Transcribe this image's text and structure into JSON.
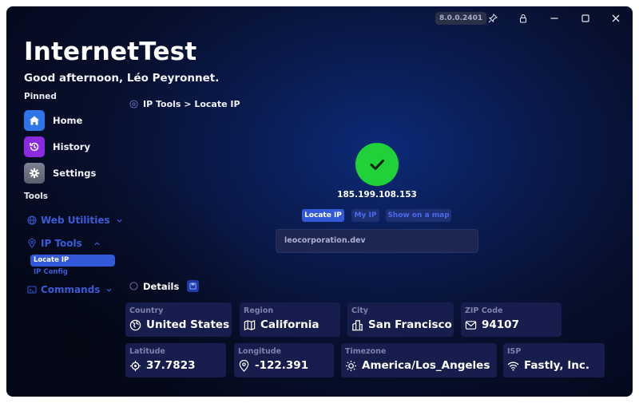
{
  "window": {
    "version": "8.0.0.2401",
    "title": "InternetTest",
    "greeting": "Good afternoon, Léo Peyronnet."
  },
  "sidebar": {
    "pinned_label": "Pinned",
    "pinned": [
      {
        "label": "Home",
        "icon": "home-icon",
        "color": "#2f74e8"
      },
      {
        "label": "History",
        "icon": "history-icon",
        "color": "#8a2be2"
      },
      {
        "label": "Settings",
        "icon": "gear-icon",
        "color": "#6d7280"
      }
    ],
    "tools_label": "Tools",
    "tools": [
      {
        "label": "Web Utilities",
        "icon": "globe-icon"
      },
      {
        "label": "IP Tools",
        "icon": "location-pin-icon",
        "sub": [
          "Locate IP",
          "IP Config"
        ]
      },
      {
        "label": "Commands",
        "icon": "terminal-icon"
      }
    ]
  },
  "main": {
    "breadcrumb": "IP Tools > Locate IP",
    "ip_address": "185.199.108.153",
    "actions": [
      "Locate IP",
      "My IP",
      "Show on a map"
    ],
    "input_value": "leocorporation.dev",
    "details_label": "Details",
    "details": [
      {
        "label": "Country",
        "value": "United States",
        "icon": "globe-icon"
      },
      {
        "label": "Region",
        "value": "California",
        "icon": "map-icon"
      },
      {
        "label": "City",
        "value": "San Francisco",
        "icon": "city-icon"
      },
      {
        "label": "ZIP Code",
        "value": "94107",
        "icon": "mail-icon"
      },
      {
        "label": "Latitude",
        "value": "37.7823",
        "icon": "crosshair-icon"
      },
      {
        "label": "Longitude",
        "value": "-122.391",
        "icon": "location-pin-icon"
      },
      {
        "label": "Timezone",
        "value": "America/Los_Angeles",
        "icon": "sun-icon"
      },
      {
        "label": "ISP",
        "value": "Fastly, Inc.",
        "icon": "wifi-icon"
      }
    ]
  },
  "colors": {
    "accent": "#3358d8",
    "success": "#1fd23a",
    "card": "#171d4c"
  }
}
